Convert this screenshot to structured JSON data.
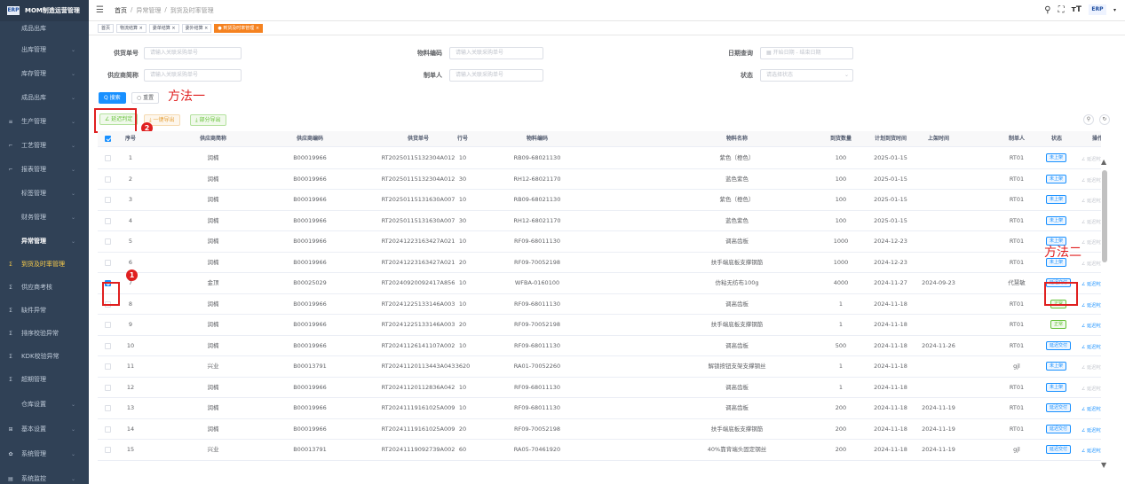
{
  "app": {
    "logo_text": "ERP",
    "title": "MOM制造运营管理"
  },
  "colors": {
    "sidebar_bg": "#304156",
    "primary": "#1890ff",
    "success": "#67c23a",
    "warning": "#e6a23c",
    "active_tag": "#f58220",
    "annotation": "#e02020"
  },
  "sidebar": {
    "items": [
      {
        "label": "成品出库",
        "icon": "",
        "active": false,
        "group": false,
        "chevron": false
      },
      {
        "label": "出库管理",
        "icon": "",
        "active": false,
        "group": false,
        "chevron": true
      },
      {
        "label": "库存管理",
        "icon": "",
        "active": false,
        "group": false,
        "chevron": true
      },
      {
        "label": "成品出库",
        "icon": "",
        "active": false,
        "group": false,
        "chevron": true
      },
      {
        "label": "生产管理",
        "icon": "≡",
        "active": false,
        "group": false,
        "chevron": true
      },
      {
        "label": "工艺管理",
        "icon": "⌐",
        "active": false,
        "group": false,
        "chevron": true
      },
      {
        "label": "报表管理",
        "icon": "⌐",
        "active": false,
        "group": false,
        "chevron": true
      },
      {
        "label": "标签管理",
        "icon": "",
        "active": false,
        "group": false,
        "chevron": true
      },
      {
        "label": "财务管理",
        "icon": "",
        "active": false,
        "group": false,
        "chevron": true
      },
      {
        "label": "异常管理",
        "icon": "",
        "active": false,
        "group": true,
        "chevron": true
      },
      {
        "label": "到货及时率管理",
        "icon": "Σ",
        "active": true,
        "group": false,
        "chevron": false
      },
      {
        "label": "供应商考核",
        "icon": "Σ",
        "active": false,
        "group": false,
        "chevron": false
      },
      {
        "label": "缺件异常",
        "icon": "Σ",
        "active": false,
        "group": false,
        "chevron": false
      },
      {
        "label": "排序校验异常",
        "icon": "Σ",
        "active": false,
        "group": false,
        "chevron": false
      },
      {
        "label": "KDK校验异常",
        "icon": "Σ",
        "active": false,
        "group": false,
        "chevron": false
      },
      {
        "label": "超期管理",
        "icon": "Σ",
        "active": false,
        "group": false,
        "chevron": false
      },
      {
        "label": "仓库设置",
        "icon": "",
        "active": false,
        "group": false,
        "chevron": true
      },
      {
        "label": "基本设置",
        "icon": "⊞",
        "active": false,
        "group": false,
        "chevron": true
      },
      {
        "label": "系统管理",
        "icon": "✿",
        "active": false,
        "group": false,
        "chevron": true
      },
      {
        "label": "系统监控",
        "icon": "▤",
        "active": false,
        "group": false,
        "chevron": true
      }
    ]
  },
  "header": {
    "breadcrumb": [
      "首页",
      "/",
      "异常管理",
      "/",
      "到货及时率管理"
    ],
    "icons": [
      "search-icon",
      "fullscreen-icon",
      "font-size-icon"
    ],
    "avatar_text": "ERP"
  },
  "tags": [
    "首页",
    "物流结算 ×",
    "委单结算 ×",
    "委外结算 ×",
    "● 到货及时率管理 ×"
  ],
  "search": {
    "fields": [
      {
        "label": "供货单号",
        "placeholder": "请输入关联采购单号"
      },
      {
        "label": "物料编码",
        "placeholder": "请输入关联采购单号"
      },
      {
        "label": "日期查询",
        "placeholder": "▦  开始日期  -  结束日期"
      },
      {
        "label": "供应商简称",
        "placeholder": "请输入关联采购单号"
      },
      {
        "label": "制单人",
        "placeholder": "请输入关联采购单号"
      },
      {
        "label": "状态",
        "placeholder": "请选择状态"
      }
    ],
    "search_btn": "Q 搜索",
    "reset_btn": "○ 重置"
  },
  "toolbar": {
    "delay_btn": "∠ 延迟判定",
    "export_all_btn": "⤓ 一键导出",
    "export_part_btn": "⤓ 部分导出"
  },
  "annotations": {
    "method1": "方法一",
    "method2": "方法二",
    "num1": "1",
    "num2": "2"
  },
  "table": {
    "columns": [
      "序号",
      "供应商简称",
      "供应商编码",
      "供货单号",
      "行号",
      "物料编码",
      "物料名称",
      "到货数量",
      "计划到货时间",
      "上架时间",
      "制单人",
      "状态",
      "操作"
    ],
    "rows": [
      {
        "no": "1",
        "supplier": "润楠",
        "code": "B00019966",
        "order": "RT20250115132304A012",
        "line": "10",
        "material": "RB09-68021130",
        "name": "紫色（橙色）",
        "qty": "100",
        "plan": "2025-01-15",
        "shelf": "",
        "creator": "RT01",
        "status": "未上架",
        "status_type": "blue",
        "checked": false
      },
      {
        "no": "2",
        "supplier": "润楠",
        "code": "B00019966",
        "order": "RT20250115132304A012",
        "line": "30",
        "material": "RH12-68021170",
        "name": "蓝色紫色",
        "qty": "100",
        "plan": "2025-01-15",
        "shelf": "",
        "creator": "RT01",
        "status": "未上架",
        "status_type": "blue",
        "checked": false
      },
      {
        "no": "3",
        "supplier": "润楠",
        "code": "B00019966",
        "order": "RT20250115131630A007",
        "line": "10",
        "material": "RB09-68021130",
        "name": "紫色（橙色）",
        "qty": "100",
        "plan": "2025-01-15",
        "shelf": "",
        "creator": "RT01",
        "status": "未上架",
        "status_type": "blue",
        "checked": false
      },
      {
        "no": "4",
        "supplier": "润楠",
        "code": "B00019966",
        "order": "RT20250115131630A007",
        "line": "30",
        "material": "RH12-68021170",
        "name": "蓝色紫色",
        "qty": "100",
        "plan": "2025-01-15",
        "shelf": "",
        "creator": "RT01",
        "status": "未上架",
        "status_type": "blue",
        "checked": false
      },
      {
        "no": "5",
        "supplier": "润楠",
        "code": "B00019966",
        "order": "RT20241223163427A021",
        "line": "10",
        "material": "RF09-68011130",
        "name": "调高齿板",
        "qty": "1000",
        "plan": "2024-12-23",
        "shelf": "",
        "creator": "RT01",
        "status": "未上架",
        "status_type": "blue",
        "checked": false
      },
      {
        "no": "6",
        "supplier": "润楠",
        "code": "B00019966",
        "order": "RT20241223163427A021",
        "line": "20",
        "material": "RF09-70052198",
        "name": "扶手端底板支撑钢筋",
        "qty": "1000",
        "plan": "2024-12-23",
        "shelf": "",
        "creator": "RT01",
        "status": "未上架",
        "status_type": "blue",
        "checked": false
      },
      {
        "no": "7",
        "supplier": "金顶",
        "code": "B00025029",
        "order": "RT20240920092417A856",
        "line": "10",
        "material": "WFBA-0160100",
        "name": "仿粘无纺布100g",
        "qty": "4000",
        "plan": "2024-11-27",
        "shelf": "2024-09-23",
        "creator": "代慧敏",
        "status": "延迟交付",
        "status_type": "blue",
        "checked": true
      },
      {
        "no": "8",
        "supplier": "润楠",
        "code": "B00019966",
        "order": "RT20241225133146A003",
        "line": "10",
        "material": "RF09-68011130",
        "name": "调高齿板",
        "qty": "1",
        "plan": "2024-11-18",
        "shelf": "",
        "creator": "RT01",
        "status": "正常",
        "status_type": "green",
        "checked": false
      },
      {
        "no": "9",
        "supplier": "润楠",
        "code": "B00019966",
        "order": "RT20241225133146A003",
        "line": "20",
        "material": "RF09-70052198",
        "name": "扶手端底板支撑钢筋",
        "qty": "1",
        "plan": "2024-11-18",
        "shelf": "",
        "creator": "RT01",
        "status": "正常",
        "status_type": "green",
        "checked": false
      },
      {
        "no": "10",
        "supplier": "润楠",
        "code": "B00019966",
        "order": "RT20241126141107A002",
        "line": "10",
        "material": "RF09-68011130",
        "name": "调高齿板",
        "qty": "500",
        "plan": "2024-11-18",
        "shelf": "2024-11-26",
        "creator": "RT01",
        "status": "延迟交付",
        "status_type": "blue",
        "checked": false
      },
      {
        "no": "11",
        "supplier": "兴业",
        "code": "B00013791",
        "order": "RT20241120113443A043",
        "line": "3620",
        "material": "RA01-70052260",
        "name": "解锁按钮支架支撑钢丝",
        "qty": "1",
        "plan": "2024-11-18",
        "shelf": "",
        "creator": "gjl",
        "status": "未上架",
        "status_type": "blue",
        "checked": false
      },
      {
        "no": "12",
        "supplier": "润楠",
        "code": "B00019966",
        "order": "RT20241120112836A042",
        "line": "10",
        "material": "RF09-68011130",
        "name": "调高齿板",
        "qty": "1",
        "plan": "2024-11-18",
        "shelf": "",
        "creator": "RT01",
        "status": "未上架",
        "status_type": "blue",
        "checked": false
      },
      {
        "no": "13",
        "supplier": "润楠",
        "code": "B00019966",
        "order": "RT20241119161025A009",
        "line": "10",
        "material": "RF09-68011130",
        "name": "调高齿板",
        "qty": "200",
        "plan": "2024-11-18",
        "shelf": "2024-11-19",
        "creator": "RT01",
        "status": "延迟交付",
        "status_type": "blue",
        "checked": false
      },
      {
        "no": "14",
        "supplier": "润楠",
        "code": "B00019966",
        "order": "RT20241119161025A009",
        "line": "20",
        "material": "RF09-70052198",
        "name": "扶手端底板支撑钢筋",
        "qty": "200",
        "plan": "2024-11-18",
        "shelf": "2024-11-19",
        "creator": "RT01",
        "status": "延迟交付",
        "status_type": "blue",
        "checked": false
      },
      {
        "no": "15",
        "supplier": "兴业",
        "code": "B00013791",
        "order": "RT20241119092739A002",
        "line": "60",
        "material": "RA05-70461920",
        "name": "40%靠背端头固定钢丝",
        "qty": "200",
        "plan": "2024-11-18",
        "shelf": "2024-11-19",
        "creator": "gjl",
        "status": "延迟交付",
        "status_type": "blue",
        "checked": false
      }
    ],
    "op_delay": "∠ 延迟判定",
    "op_detail": "○ 删除"
  }
}
